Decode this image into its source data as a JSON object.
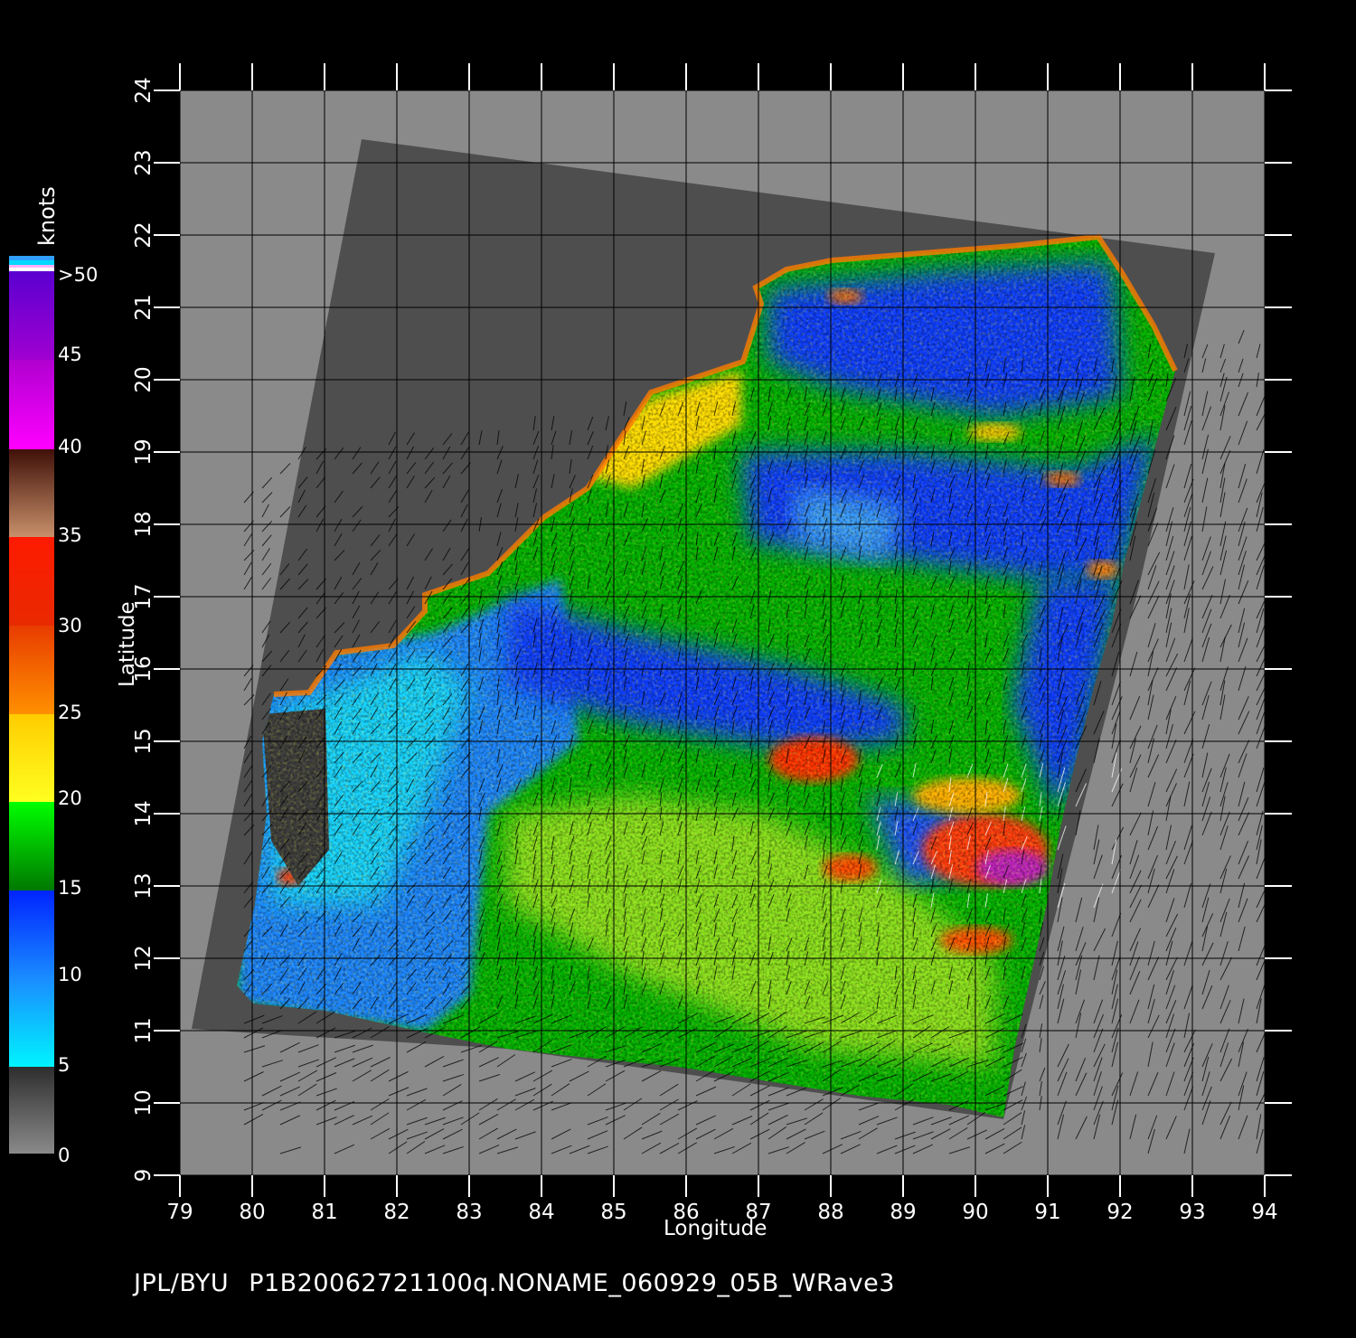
{
  "footer": {
    "source": "JPL/BYU",
    "product": "P1B20062721100q.NONAME_060929_05B_WRave3"
  },
  "axes": {
    "x_title": "Longitude",
    "y_title": "Latitude",
    "x_range": [
      79,
      94
    ],
    "y_range": [
      9,
      24
    ],
    "x_ticks": [
      "79",
      "80",
      "81",
      "82",
      "83",
      "84",
      "85",
      "86",
      "87",
      "88",
      "89",
      "90",
      "91",
      "92",
      "93",
      "94"
    ],
    "y_ticks": [
      "9",
      "10",
      "11",
      "12",
      "13",
      "14",
      "15",
      "16",
      "17",
      "18",
      "19",
      "20",
      "21",
      "22",
      "23",
      "24"
    ],
    "grid": true
  },
  "colorbar": {
    "title": "knots",
    "labels": [
      "0",
      "5",
      "10",
      "15",
      "20",
      "25",
      "30",
      "35",
      "40",
      "45",
      ">50"
    ],
    "colors": {
      "gray_low": "#888888",
      "gray_high": "#333333",
      "cyan": "#00f4ff",
      "light_blue": "#1a9bff",
      "blue": "#0022ff",
      "dark_green": "#007a00",
      "green": "#00ff00",
      "yellow": "#ffff20",
      "gold": "#ffcc00",
      "orange": "#ff7a00",
      "red_orange": "#e83c00",
      "red": "#ff1a00",
      "tan": "#c8906a",
      "brown": "#5a2010",
      "magenta": "#ff00ff",
      "purple": "#8a00cc",
      "violet": "#5a00d0"
    }
  },
  "map": {
    "background_color": "#8a8a8a",
    "swath_color": "#4e4e4e",
    "land_note_color": "#3a3a3a"
  }
}
